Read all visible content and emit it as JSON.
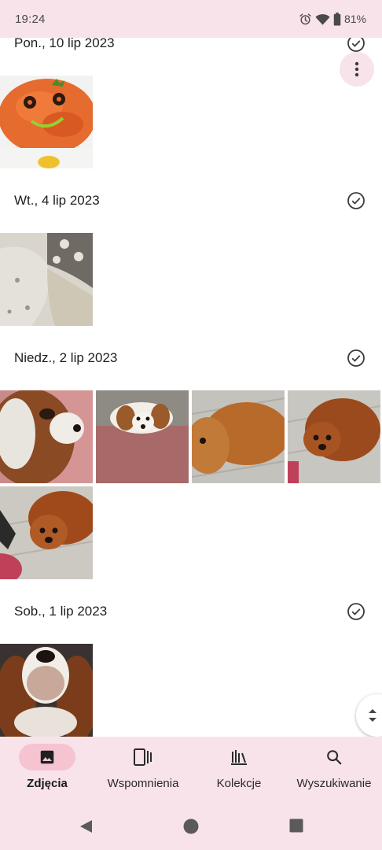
{
  "status_bar": {
    "time": "19:24",
    "battery": "81%",
    "icons": [
      "alarm-icon",
      "wifi-icon",
      "battery-icon"
    ]
  },
  "sections": [
    {
      "date": "Pon., 10 lip 2023",
      "photos": [
        "salad-face-photo"
      ]
    },
    {
      "date": "Wt., 4 lip 2023",
      "photos": [
        "blanket-photo"
      ]
    },
    {
      "date": "Niedz., 2 lip 2023",
      "photos": [
        "dog-closeup-photo",
        "dog-on-cushion-photo",
        "dog-on-floor-photo",
        "dog-lying-photo",
        "dog-lying-2-photo"
      ]
    },
    {
      "date": "Sob., 1 lip 2023",
      "photos": [
        "dog-portrait-photo"
      ]
    }
  ],
  "bottom_nav": {
    "items": [
      {
        "label": "Zdjęcia",
        "icon": "photo-icon",
        "active": true
      },
      {
        "label": "Wspomnienia",
        "icon": "memories-icon",
        "active": false
      },
      {
        "label": "Kolekcje",
        "icon": "library-icon",
        "active": false
      },
      {
        "label": "Wyszukiwanie",
        "icon": "search-icon",
        "active": false
      }
    ]
  },
  "colors": {
    "bar_background": "#f8e3ea",
    "active_pill": "#f6c3d1",
    "text": "#1f1f1f"
  }
}
